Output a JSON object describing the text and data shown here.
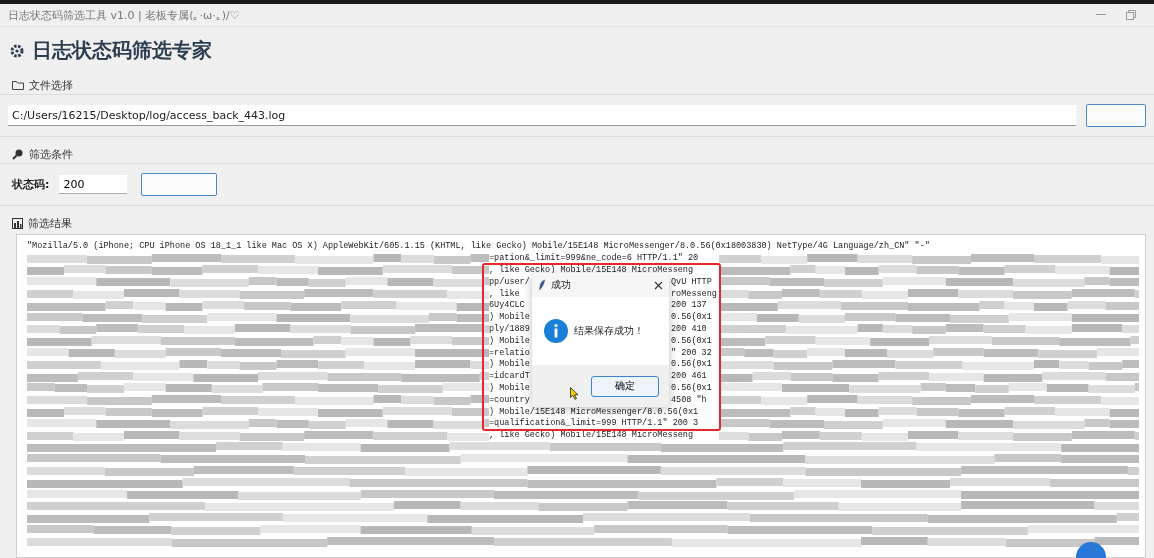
{
  "window": {
    "title": "日志状态码筛选工具 v1.0 | 老板专属(｡·ω·｡)/♡"
  },
  "header": {
    "title": "日志状态码筛选专家"
  },
  "file_section": {
    "label": "文件选择",
    "path": "C:/Users/16215/Desktop/log/access_back_443.log"
  },
  "filter_section": {
    "label": "筛选条件",
    "status_label": "状态码:",
    "status_value": "200"
  },
  "result_section": {
    "label": "筛选结果",
    "rows": [
      {
        "kind": "full",
        "text": "\"Mozilla/5.0 (iPhone; CPU iPhone OS 18_1_1 like Mac OS X) AppleWebKit/605.1.15 (KHTML, like Gecko) Mobile/15E148 MicroMessenger/8.0.56(0x18003830) NetType/4G Language/zh_CN\" \"-\""
      },
      {
        "kind": "mid",
        "text": "=pation&_limit=999&ne_code=6 HTTP/1.1\" 20"
      },
      {
        "kind": "mid",
        "text": ", like Gecko) Mobile/15E148 MicroMesseng"
      },
      {
        "kind": "split",
        "left": "pp/user/",
        "right": "QvU HTTP"
      },
      {
        "kind": "split",
        "left": ", like",
        "right": "roMesseng"
      },
      {
        "kind": "split",
        "left": "6Uy4CLC",
        "right": "200 137"
      },
      {
        "kind": "split",
        "left": ") Mobile",
        "right": "0.56(0x1"
      },
      {
        "kind": "split",
        "left": "ply/1889",
        "right": "200 410"
      },
      {
        "kind": "split",
        "left": ") Mobile",
        "right": "0.56(0x1"
      },
      {
        "kind": "split",
        "left": "=relatio",
        "right": "\" 200 32"
      },
      {
        "kind": "split",
        "left": ") Mobile",
        "right": "0.56(0x1"
      },
      {
        "kind": "split",
        "left": "=idcardT",
        "right": "200 461"
      },
      {
        "kind": "split",
        "left": ") Mobile",
        "right": "0.56(0x1"
      },
      {
        "kind": "split",
        "left": "=country",
        "right": "4508 \"h"
      },
      {
        "kind": "mid",
        "text": ") Mobile/15E148 MicroMessenger/8.0.56(0x1"
      },
      {
        "kind": "mid",
        "text": "=qualification&_limit=999 HTTP/1.1\" 200 3"
      },
      {
        "kind": "mid",
        "text": ", like Gecko) Mobile/15E148 MicroMesseng"
      },
      {
        "kind": "blurred"
      },
      {
        "kind": "blurred"
      },
      {
        "kind": "blurred"
      },
      {
        "kind": "blurred"
      },
      {
        "kind": "blurred"
      },
      {
        "kind": "blurred"
      },
      {
        "kind": "blurred"
      },
      {
        "kind": "blurred"
      },
      {
        "kind": "blurred"
      }
    ]
  },
  "dialog": {
    "title": "成功",
    "message": "结果保存成功！",
    "ok_button": "确定"
  }
}
